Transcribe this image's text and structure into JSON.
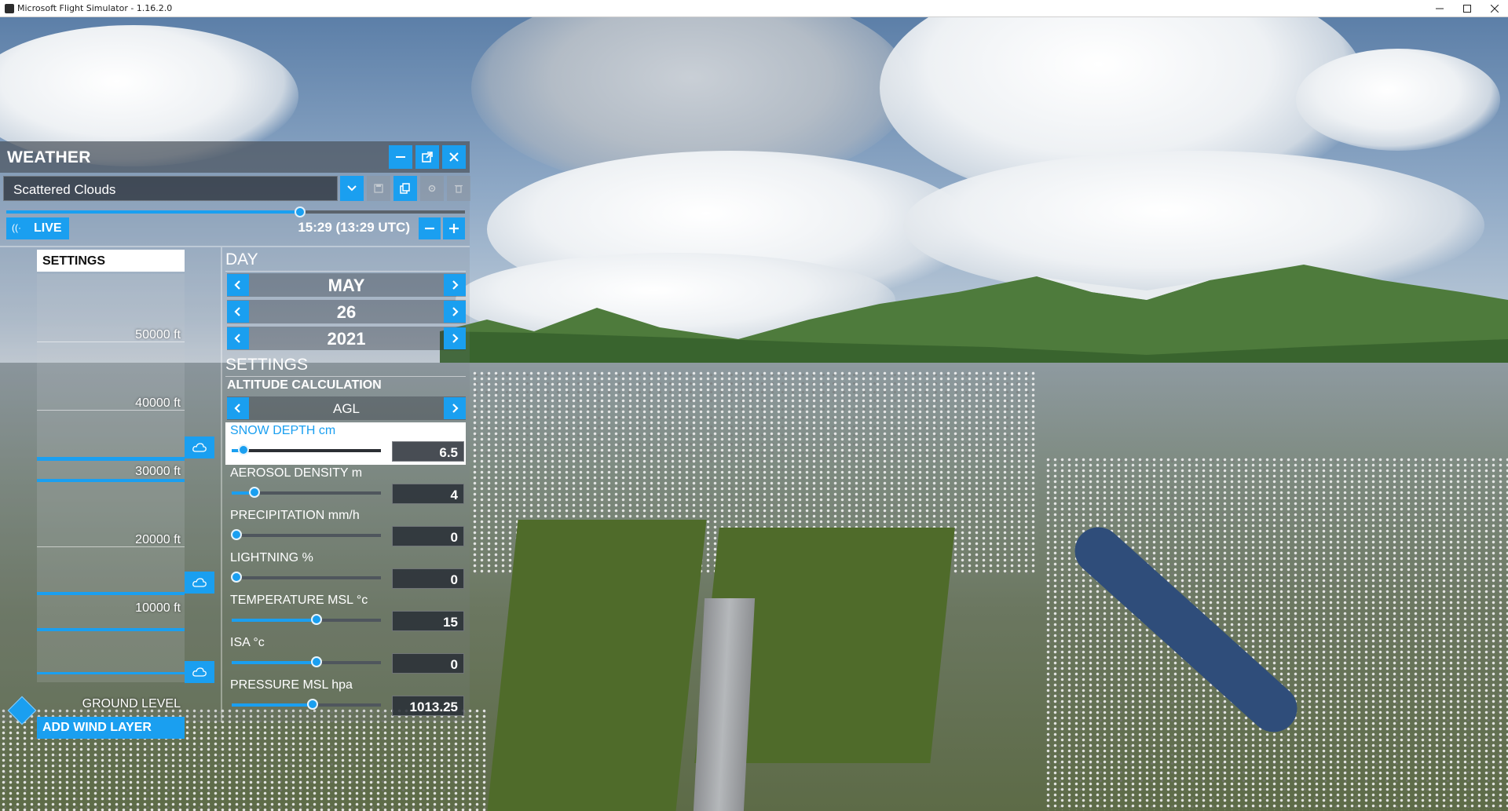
{
  "window": {
    "title": "Microsoft Flight Simulator - 1.16.2.0"
  },
  "weather_panel": {
    "title": "WEATHER",
    "preset": {
      "value": "Scattered Clouds"
    },
    "time": {
      "live_label": "LIVE",
      "display": "15:29 (13:29 UTC)",
      "slider_fraction": 0.64
    },
    "altitude_column": {
      "settings_label": "SETTINGS",
      "altitude_labels": [
        "50000 ft",
        "40000 ft",
        "30000 ft",
        "20000 ft",
        "10000 ft"
      ],
      "ground_label": "GROUND LEVEL",
      "add_wind_label": "ADD WIND LAYER"
    },
    "day": {
      "title": "DAY",
      "month": "MAY",
      "date": "26",
      "year": "2021"
    },
    "settings": {
      "title": "SETTINGS",
      "altitude_calculation_label": "ALTITUDE CALCULATION",
      "altitude_calculation_value": "AGL",
      "sliders": [
        {
          "label": "SNOW DEPTH cm",
          "value": "6.5",
          "fraction": 0.08,
          "highlighted": true
        },
        {
          "label": "AEROSOL DENSITY m",
          "value": "4",
          "fraction": 0.15,
          "highlighted": false
        },
        {
          "label": "PRECIPITATION mm/h",
          "value": "0",
          "fraction": 0.03,
          "highlighted": false
        },
        {
          "label": "LIGHTNING %",
          "value": "0",
          "fraction": 0.03,
          "highlighted": false
        },
        {
          "label": "TEMPERATURE MSL °c",
          "value": "15",
          "fraction": 0.57,
          "highlighted": false
        },
        {
          "label": "ISA °c",
          "value": "0",
          "fraction": 0.57,
          "highlighted": false
        },
        {
          "label": "PRESSURE MSL hpa",
          "value": "1013.25",
          "fraction": 0.54,
          "highlighted": false
        }
      ]
    },
    "accent_color": "#1a9ff0"
  }
}
